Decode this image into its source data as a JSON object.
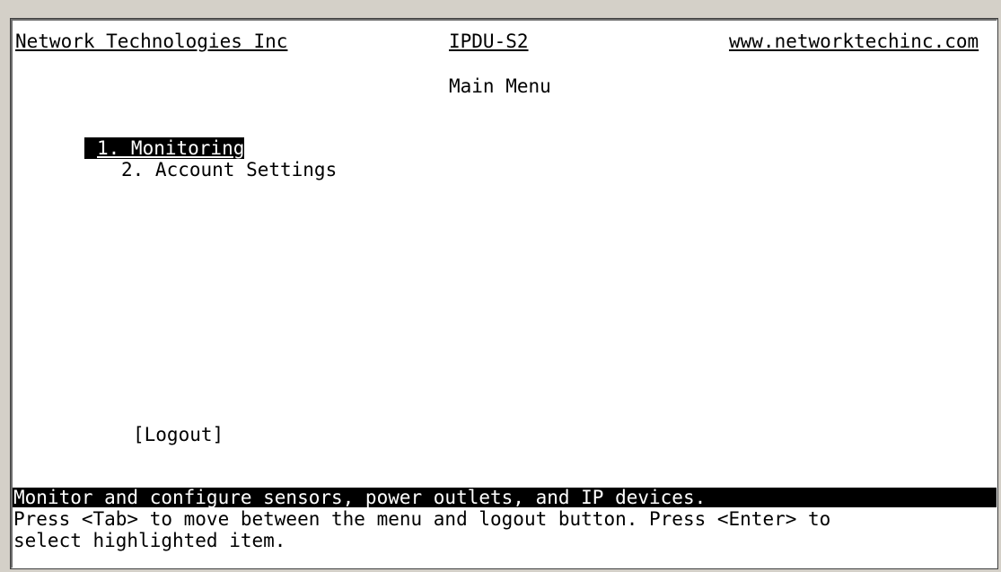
{
  "header": {
    "company": "Network Technologies Inc",
    "device": "IPDU-S2",
    "website": "www.networktechinc.com"
  },
  "page": {
    "title": "Main Menu"
  },
  "menu": {
    "items": [
      {
        "label": "1. Monitoring",
        "selected": true
      },
      {
        "label": "2. Account Settings",
        "selected": false
      }
    ]
  },
  "buttons": {
    "logout": "[Logout]"
  },
  "status": {
    "description": "Monitor and configure sensors, power outlets, and IP devices.",
    "help_line_1": "Press <Tab> to move between the menu and logout button. Press <Enter> to",
    "help_line_2": "select highlighted item."
  },
  "colors": {
    "background": "#ffffff",
    "text": "#000000",
    "highlight_bg": "#000000",
    "highlight_text": "#ffffff",
    "frame": "#d4d0c8"
  }
}
